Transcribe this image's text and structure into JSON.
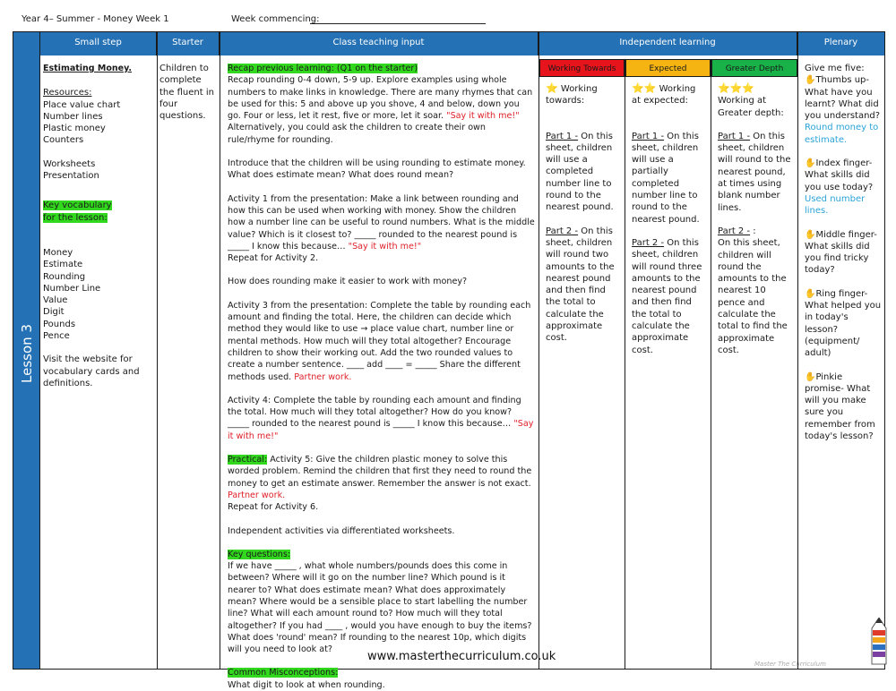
{
  "header": {
    "title": "Year 4– Summer - Money Week 1",
    "week_commencing": "Week commencing:"
  },
  "lesson_label": "Lesson 3",
  "columns": {
    "small_step": "Small step",
    "starter": "Starter",
    "class_teaching": "Class teaching input",
    "independent": "Independent learning",
    "plenary": "Plenary"
  },
  "small_step": {
    "title": "Estimating Money.",
    "resources_heading": "Resources:",
    "resources": [
      "Place value chart",
      "Number lines",
      "Plastic money",
      "Counters"
    ],
    "resources2": [
      "Worksheets",
      "Presentation"
    ],
    "vocab_heading": "Key vocabulary for the lesson:",
    "vocab": [
      "Money",
      "Estimate",
      "Rounding",
      "Number Line",
      "Value",
      "Digit",
      "Pounds",
      "Pence"
    ],
    "website_note": "Visit the website for vocabulary cards and definitions."
  },
  "starter": {
    "text": "Children to complete the fluent in four questions."
  },
  "teaching": {
    "recap_label": "Recap previous learning: (Q1 on the starter)",
    "recap_text": "Recap rounding 0-4 down, 5-9 up. Explore examples using whole numbers to make links in knowledge. There are many rhymes that can be used for this: 5 and above up you shove, 4 and below, down you go. Four or less, let it rest, five or more, let it soar.",
    "say_it": "\"Say it with me!\"",
    "recap_text2": "Alternatively, you could ask the children to create their own rule/rhyme for rounding.",
    "intro": "Introduce that the children will be using rounding to estimate money. What does estimate mean? What does round mean?",
    "activity1": "Activity 1 from the presentation: Make a link between rounding and how this can be used when working with money. Show the children how a number line can be useful to round numbers. What is the middle value? Which is it closest to? _____ rounded to the nearest pound is _____ I know this because…",
    "repeat2": "Repeat for Activity 2.",
    "question": "How does rounding make it easier to work with money?",
    "activity3": "Activity 3 from the presentation: Complete the table by rounding each amount and finding the total. Here, the children can decide which method they would like to use → place value chart, number line or mental methods.  How much will they total altogether? Encourage children to show their working out. Add the two rounded values to create a number sentence. ____ add ____ = _____ Share the different methods used.",
    "partner_work": "Partner work.",
    "activity4": "Activity 4: Complete the table by rounding each amount and finding the total. How much will they total altogether? How do you know? _____ rounded to the nearest pound is _____ I know this because…",
    "practical_label": "Practical:",
    "activity5": "Activity 5:  Give the children plastic money to solve this worded problem. Remind the children that first they need to round the money to get an estimate answer. Remember the answer is not exact.",
    "repeat6": "Repeat for Activity 6.",
    "independent": "Independent activities via differentiated worksheets.",
    "key_q_label": "Key questions:",
    "key_questions": "If we have _____ , what whole numbers/pounds does this come in between? Where will it go on the number line? Which pound is it nearer to? What does estimate mean? What does approximately mean? Where would be a sensible place to start labelling the number line? What will each amount round to? How much will they total altogether? If you had ____ , would you have enough to buy the items? What does 'round' mean? If rounding to the nearest 10p, which digits will you need to look at?",
    "misconceptions_label": "Common Misconceptions:",
    "misconceptions": "What digit to look at when rounding."
  },
  "independent": {
    "levels": [
      {
        "label": "Working Towards",
        "color": "#e8141c"
      },
      {
        "label": "Expected",
        "color": "#f6b412"
      },
      {
        "label": "Greater Depth",
        "color": "#18b248"
      }
    ],
    "wt": {
      "stars": "⭐",
      "intro": "Working towards:",
      "p1_label": "Part 1 -",
      "p1": "On this sheet, children will use a completed number line to round to the nearest pound.",
      "p2_label": "Part 2 -",
      "p2": "On this sheet, children will round two amounts to the nearest pound and then find the total to calculate the approximate cost."
    },
    "exp": {
      "stars": "⭐⭐",
      "intro": "Working at expected:",
      "p1_label": "Part 1 -",
      "p1": "On this sheet, children will use a partially completed number line to round to the nearest pound.",
      "p2_label": "Part 2 -",
      "p2": "On this sheet, children will round three amounts to the nearest pound and then find the total to calculate the approximate cost."
    },
    "gd": {
      "stars": "⭐⭐⭐",
      "intro": "Working at Greater depth:",
      "p1_label": "Part 1 -",
      "p1": "On this sheet, children will round to the nearest pound, at times using blank number lines.",
      "p2_label": "Part 2 -",
      "p2_suffix": ":",
      "p2": "On this sheet, children will round the amounts to the nearest 10 pence and calculate the total to find the approximate cost."
    }
  },
  "plenary": {
    "intro": "Give me five:",
    "thumb": "Thumbs up- What have you learnt? What did you understand?",
    "thumb_answer": "Round money to estimate.",
    "index": "Index finger- What skills did you use today?",
    "index_answer": "Used number lines.",
    "middle": "Middle finger- What skills did you find tricky today?",
    "ring": "Ring finger- What helped you in today's lesson? (equipment/ adult)",
    "pinkie": "Pinkie promise- What will you make sure you remember from today's lesson?"
  },
  "footer": {
    "url": "www.masterthecurriculum.co.uk",
    "brand": "Master  The  Curriculum"
  }
}
